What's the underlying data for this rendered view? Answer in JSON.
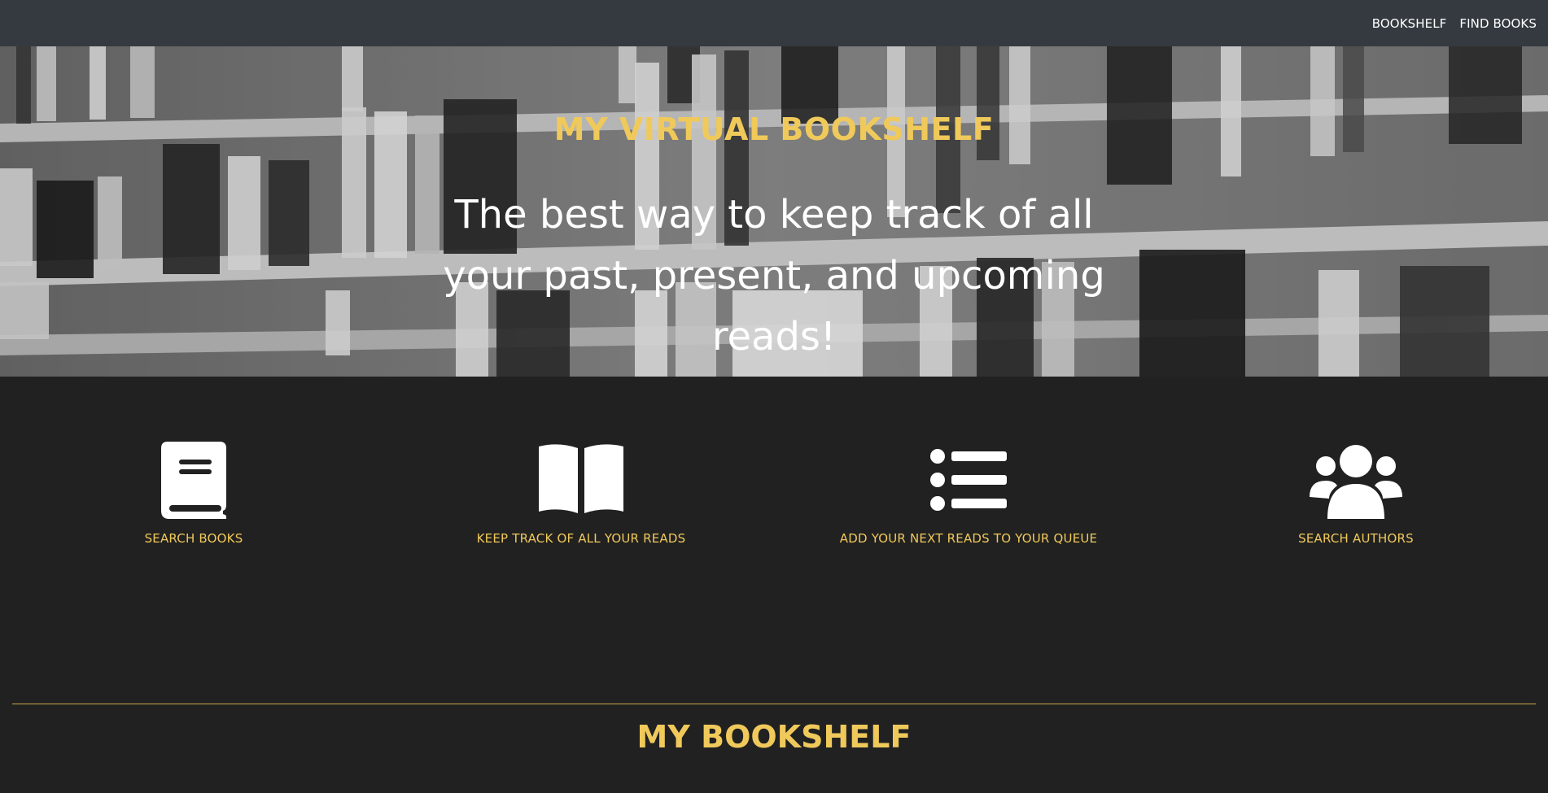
{
  "nav": {
    "links": [
      "BOOKSHELF",
      "FIND BOOKS"
    ]
  },
  "hero": {
    "title": "MY VIRTUAL BOOKSHELF",
    "tagline": "The best way to keep track of all your past, present, and upcoming reads!"
  },
  "features": [
    {
      "label": "SEARCH BOOKS",
      "icon": "book-icon"
    },
    {
      "label": "KEEP TRACK OF ALL YOUR READS",
      "icon": "book-open-icon"
    },
    {
      "label": "ADD YOUR NEXT READS TO YOUR QUEUE",
      "icon": "list-icon"
    },
    {
      "label": "SEARCH AUTHORS",
      "icon": "users-icon"
    }
  ],
  "section": {
    "title": "MY BOOKSHELF"
  },
  "colors": {
    "accent": "#f0c95b",
    "navbar": "#343a40",
    "background": "#212121"
  }
}
